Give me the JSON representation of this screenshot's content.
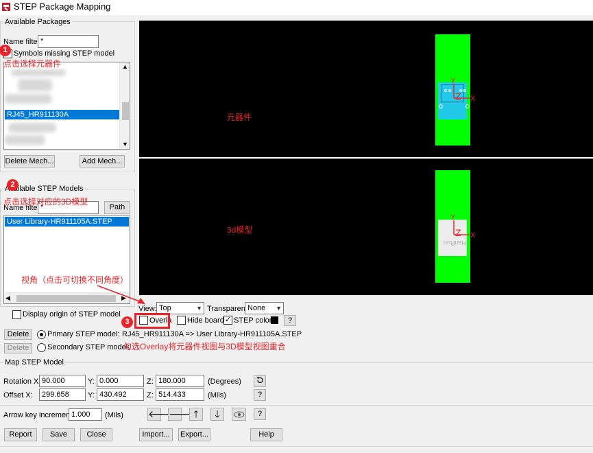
{
  "window": {
    "title": "STEP Package Mapping"
  },
  "available_packages": {
    "group_label": "Available Packages",
    "name_filter_label": "Name filter:",
    "name_filter_value": "*",
    "missing_label": "Symbols missing STEP model",
    "selected_item": "RJ45_HR911130A",
    "delete_mech": "Delete Mech...",
    "add_mech": "Add Mech..."
  },
  "available_models": {
    "group_label": "Available STEP Models",
    "name_filter_label": "Name filter:",
    "name_filter_value": "*",
    "path_button": "Path",
    "selected_item": "User Library-HR911105A.STEP",
    "display_origin_label": "Display origin of STEP model"
  },
  "view_controls": {
    "view_label": "View:",
    "view_value": "Top",
    "transparent_label": "Transparent:",
    "transparent_value": "None",
    "overlay_label": "Overla",
    "hide_board_label": "Hide board",
    "step_color_label": "STEP color",
    "help_button": "?"
  },
  "mapping": {
    "delete1": "Delete",
    "primary_label": "Primary STEP model:",
    "primary_value": "RJ45_HR911130A => User Library-HR911105A.STEP",
    "delete2": "Delete",
    "secondary_label": "Secondary STEP model:"
  },
  "map_step_model": {
    "group_label": "Map STEP Model",
    "rotation_label": "Rotation X:",
    "rotation_x": "90.000",
    "rotation_y": "0.000",
    "rotation_z": "180.000",
    "rotation_unit": "(Degrees)",
    "offset_label": "Offset X:",
    "offset_x": "299.658",
    "offset_y": "430.492",
    "offset_z": "514.433",
    "offset_unit": "(Mils)",
    "y_label": "Y:",
    "z_label": "Z:",
    "help": "?"
  },
  "arrow_key": {
    "label": "Arrow key increment:",
    "value": "1.000",
    "unit": "(Mils)",
    "help": "?"
  },
  "bottom_buttons": {
    "report": "Report",
    "save": "Save",
    "close": "Close",
    "import": "Import...",
    "export": "Export...",
    "help": "Help"
  },
  "annotations": {
    "badge1": "1",
    "badge2": "2",
    "badge3": "3",
    "note1": "点击选择元器件",
    "note2": "点击选择对应的3D模型",
    "note_view": "视角（点击可切换不同角度）",
    "note_overlay": "勾选Overlay将元器件视图与3D模型视图重合",
    "label_component": "元器件",
    "label_3d": "3d模型"
  },
  "viewport_axes": {
    "y": "Y",
    "z": "Z",
    "x": "X"
  },
  "colors": {
    "board": "#00ff00",
    "annotation": "#e8242a",
    "selection": "#0078d7",
    "component_body": "#22c8e8"
  }
}
